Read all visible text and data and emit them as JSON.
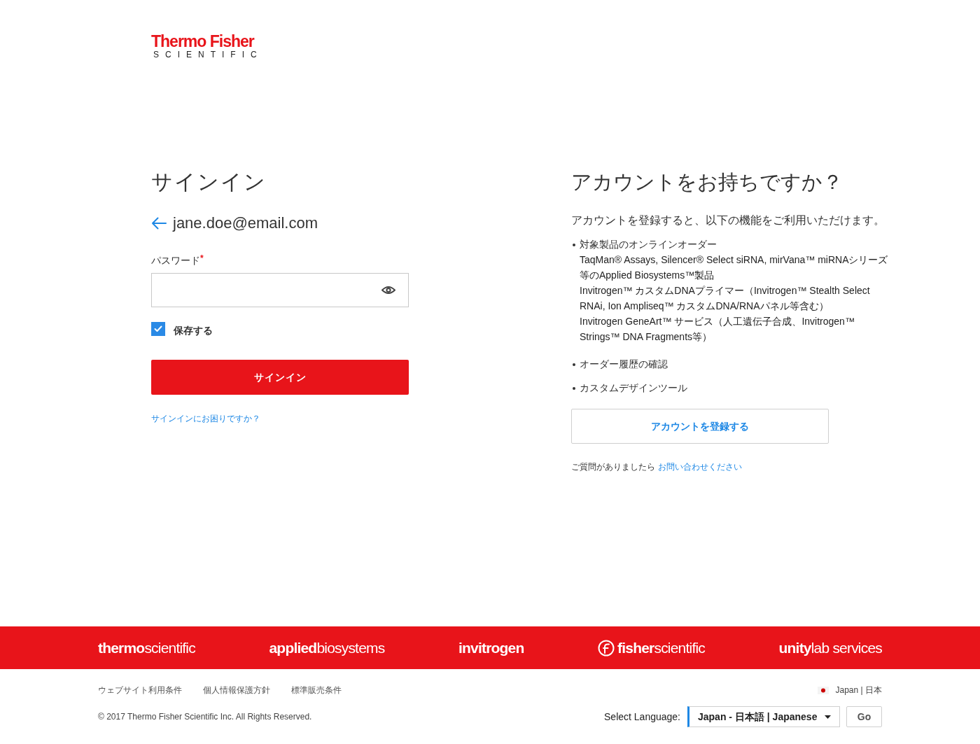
{
  "header": {
    "logo": {
      "name": "Thermo Fisher",
      "tagline": "SCIENTIFIC"
    }
  },
  "sign_in": {
    "title": "サインイン",
    "email": "jane.doe@email.com",
    "password": {
      "label": "パスワード",
      "required_mark": "*"
    },
    "remember": {
      "label": "保存する",
      "checked": true
    },
    "submit": "サインイン",
    "help_link": "サインインにお困りですか？"
  },
  "register": {
    "title": "アカウントをお持ちですか？",
    "intro": "アカウントを登録すると、以下の機能をご利用いただけます。",
    "features": [
      {
        "text": "対象製品のオンラインオーダー",
        "details": [
          "TaqMan® Assays, Silencer® Select siRNA, mirVana™ miRNAシリーズ等のApplied Biosystems™製品",
          "Invitrogen™ カスタムDNAプライマー（Invitrogen™ Stealth Select RNAi, Ion Ampliseq™ カスタムDNA/RNAパネル等含む）",
          "Invitrogen GeneArt™ サービス（人工遺伝子合成、Invitrogen™ Strings™ DNA Fragments等）"
        ]
      },
      {
        "text": "オーダー履歴の確認"
      },
      {
        "text": "カスタムデザインツール"
      }
    ],
    "button": "アカウントを登録する",
    "contact": {
      "text": "ご質問がありましたら",
      "link": "お問い合わせください"
    }
  },
  "footer": {
    "brands": [
      {
        "bold": "thermo",
        "light": "scientific",
        "mark": false
      },
      {
        "bold": "applied",
        "light": "biosystems",
        "mark": false
      },
      {
        "bold": "invitrogen",
        "mark": false
      },
      {
        "bold": "fisher",
        "light": "scientific",
        "mark": true
      },
      {
        "bold": "unity",
        "light": "lab services",
        "mark": false
      }
    ],
    "links": [
      "ウェブサイト利用条件",
      "個人情報保護方針",
      "標準販売条件"
    ],
    "region": "Japan | 日本",
    "copyright": "© 2017 Thermo Fisher Scientific Inc. All Rights Reserved.",
    "language": {
      "label": "Select Language:",
      "value": "Japan - 日本語 | Japanese",
      "button": "Go"
    }
  }
}
